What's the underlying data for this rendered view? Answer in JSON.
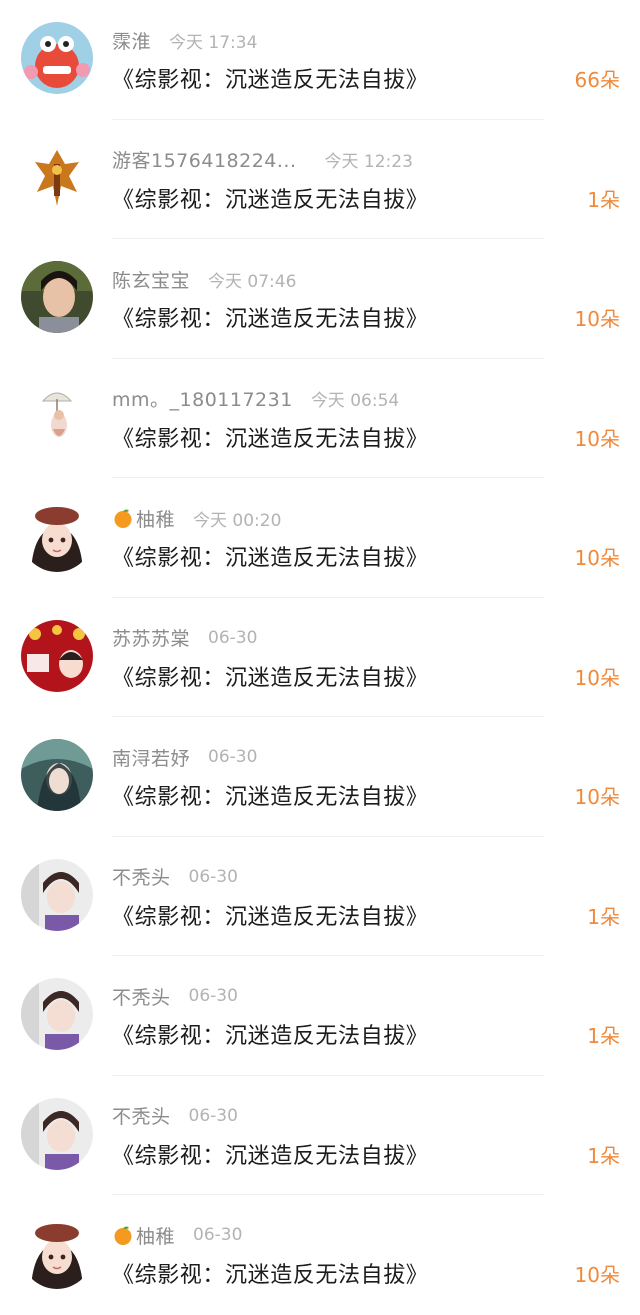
{
  "gift_list": [
    {
      "user": "霂淮",
      "emoji": "",
      "time": "今天 17:34",
      "book": "《综影视：沉迷造反无法自拔》",
      "count": "66朵",
      "avatar_icon": "cartoon-crab-avatar"
    },
    {
      "user": "游客1576418224...",
      "emoji": "",
      "time": "今天 12:23",
      "book": "《综影视：沉迷造反无法自拔》",
      "count": "1朵",
      "avatar_icon": "game-emblem-avatar"
    },
    {
      "user": "陈玄宝宝",
      "emoji": "",
      "time": "今天 07:46",
      "book": "《综影视：沉迷造反无法自拔》",
      "count": "10朵",
      "avatar_icon": "girl-photo-avatar"
    },
    {
      "user": "mm。_180117231",
      "emoji": "",
      "time": "今天 06:54",
      "book": "《综影视：沉迷造反无法自拔》",
      "count": "10朵",
      "avatar_icon": "umbrella-figure-avatar"
    },
    {
      "user": "柚稚",
      "emoji": "🍊",
      "time": "今天 00:20",
      "book": "《综影视：沉迷造反无法自拔》",
      "count": "10朵",
      "avatar_icon": "anime-girl-beret-avatar"
    },
    {
      "user": "苏苏苏棠",
      "emoji": "",
      "time": "06-30",
      "book": "《综影视：沉迷造反无法自拔》",
      "count": "10朵",
      "avatar_icon": "red-festival-avatar"
    },
    {
      "user": "南浔若妤",
      "emoji": "",
      "time": "06-30",
      "book": "《综影视：沉迷造反无法自拔》",
      "count": "10朵",
      "avatar_icon": "teal-fantasy-avatar"
    },
    {
      "user": "不秃头",
      "emoji": "",
      "time": "06-30",
      "book": "《综影视：沉迷造反无法自拔》",
      "count": "1朵",
      "avatar_icon": "girl-selfie-avatar"
    },
    {
      "user": "不秃头",
      "emoji": "",
      "time": "06-30",
      "book": "《综影视：沉迷造反无法自拔》",
      "count": "1朵",
      "avatar_icon": "girl-selfie-avatar"
    },
    {
      "user": "不秃头",
      "emoji": "",
      "time": "06-30",
      "book": "《综影视：沉迷造反无法自拔》",
      "count": "1朵",
      "avatar_icon": "girl-selfie-avatar"
    },
    {
      "user": "柚稚",
      "emoji": "🍊",
      "time": "06-30",
      "book": "《综影视：沉迷造反无法自拔》",
      "count": "10朵",
      "avatar_icon": "anime-girl-beret-avatar"
    }
  ],
  "colors": {
    "count": "#f0893a",
    "name": "#8c8c8c",
    "time": "#b3b3b3",
    "title": "#1c1c1c"
  }
}
